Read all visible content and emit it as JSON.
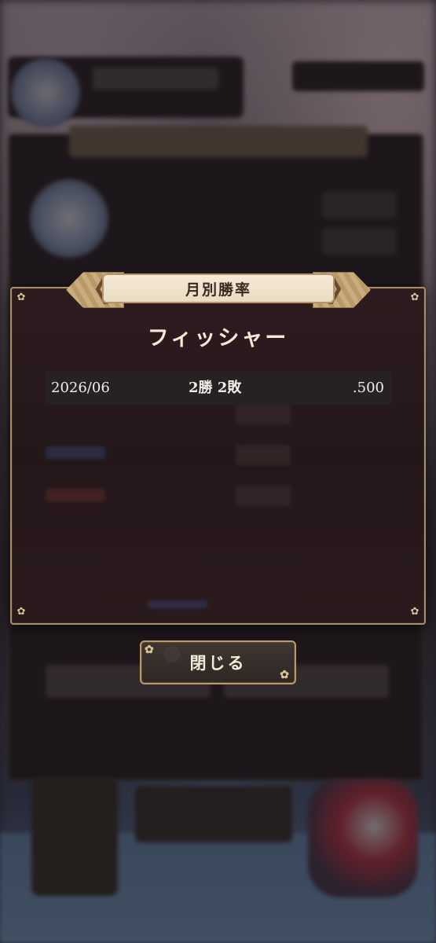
{
  "dialog": {
    "title": "月別勝率",
    "player_name": "フィッシャー",
    "rows": [
      {
        "month": "2026/06",
        "record": "2勝 2敗",
        "rate": ".500"
      }
    ],
    "close_label": "閉じる"
  },
  "icons": {
    "corner_ornament": "sakura-flower-icon"
  },
  "colors": {
    "frame_gold": "#a88d66",
    "panel_bg": "#2d1c1f",
    "title_plate": "#f4ead7",
    "text_light": "#f3ead8"
  }
}
